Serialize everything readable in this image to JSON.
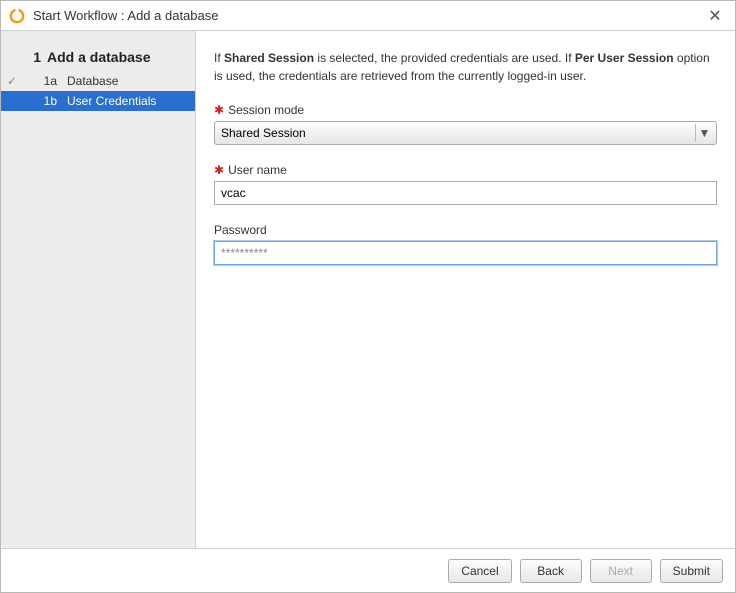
{
  "titlebar": {
    "title": "Start Workflow : Add a database"
  },
  "sidebar": {
    "root": {
      "num": "1",
      "label": "Add a database"
    },
    "steps": [
      {
        "id": "1a",
        "label": "Database",
        "completed": true,
        "active": false
      },
      {
        "id": "1b",
        "label": "User Credentials",
        "completed": false,
        "active": true
      }
    ]
  },
  "content": {
    "intro_prefix": "If ",
    "intro_bold1": "Shared Session",
    "intro_mid": " is selected, the provided credentials are used. If ",
    "intro_bold2": "Per User Session",
    "intro_suffix": " option is used, the credentials are retrieved from the currently logged-in user.",
    "session_mode": {
      "label": "Session mode",
      "required": true,
      "value": "Shared Session"
    },
    "username": {
      "label": "User name",
      "required": true,
      "value": "vcac"
    },
    "password": {
      "label": "Password",
      "required": false,
      "value": "**********"
    }
  },
  "footer": {
    "cancel": "Cancel",
    "back": "Back",
    "next": "Next",
    "submit": "Submit",
    "next_disabled": true
  }
}
